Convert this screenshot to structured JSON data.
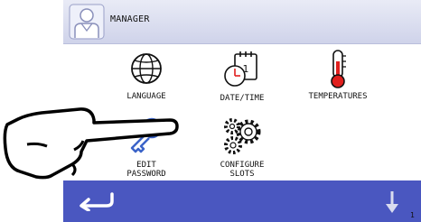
{
  "header": {
    "title": "MANAGER",
    "avatar_icon": "manager-user-icon"
  },
  "menu": [
    {
      "label": "LANGUAGE",
      "icon": "globe-icon"
    },
    {
      "label": "DATE/TIME",
      "icon": "calendar-clock-icon"
    },
    {
      "label": "TEMPERATURES",
      "icon": "thermometer-icon"
    },
    {
      "label": "EDIT\nPASSWORD",
      "icon": "key-icon"
    },
    {
      "label": "CONFIGURE\nSLOTS",
      "icon": "gears-icon"
    }
  ],
  "footer": {
    "back_icon": "back-arrow-icon",
    "down_icon": "down-arrow-icon",
    "page": "1"
  },
  "colors": {
    "header": "#dcdff0",
    "footer": "#4a57c0",
    "icon_blue": "#3b63c8",
    "thermo_red": "#e0201e"
  }
}
